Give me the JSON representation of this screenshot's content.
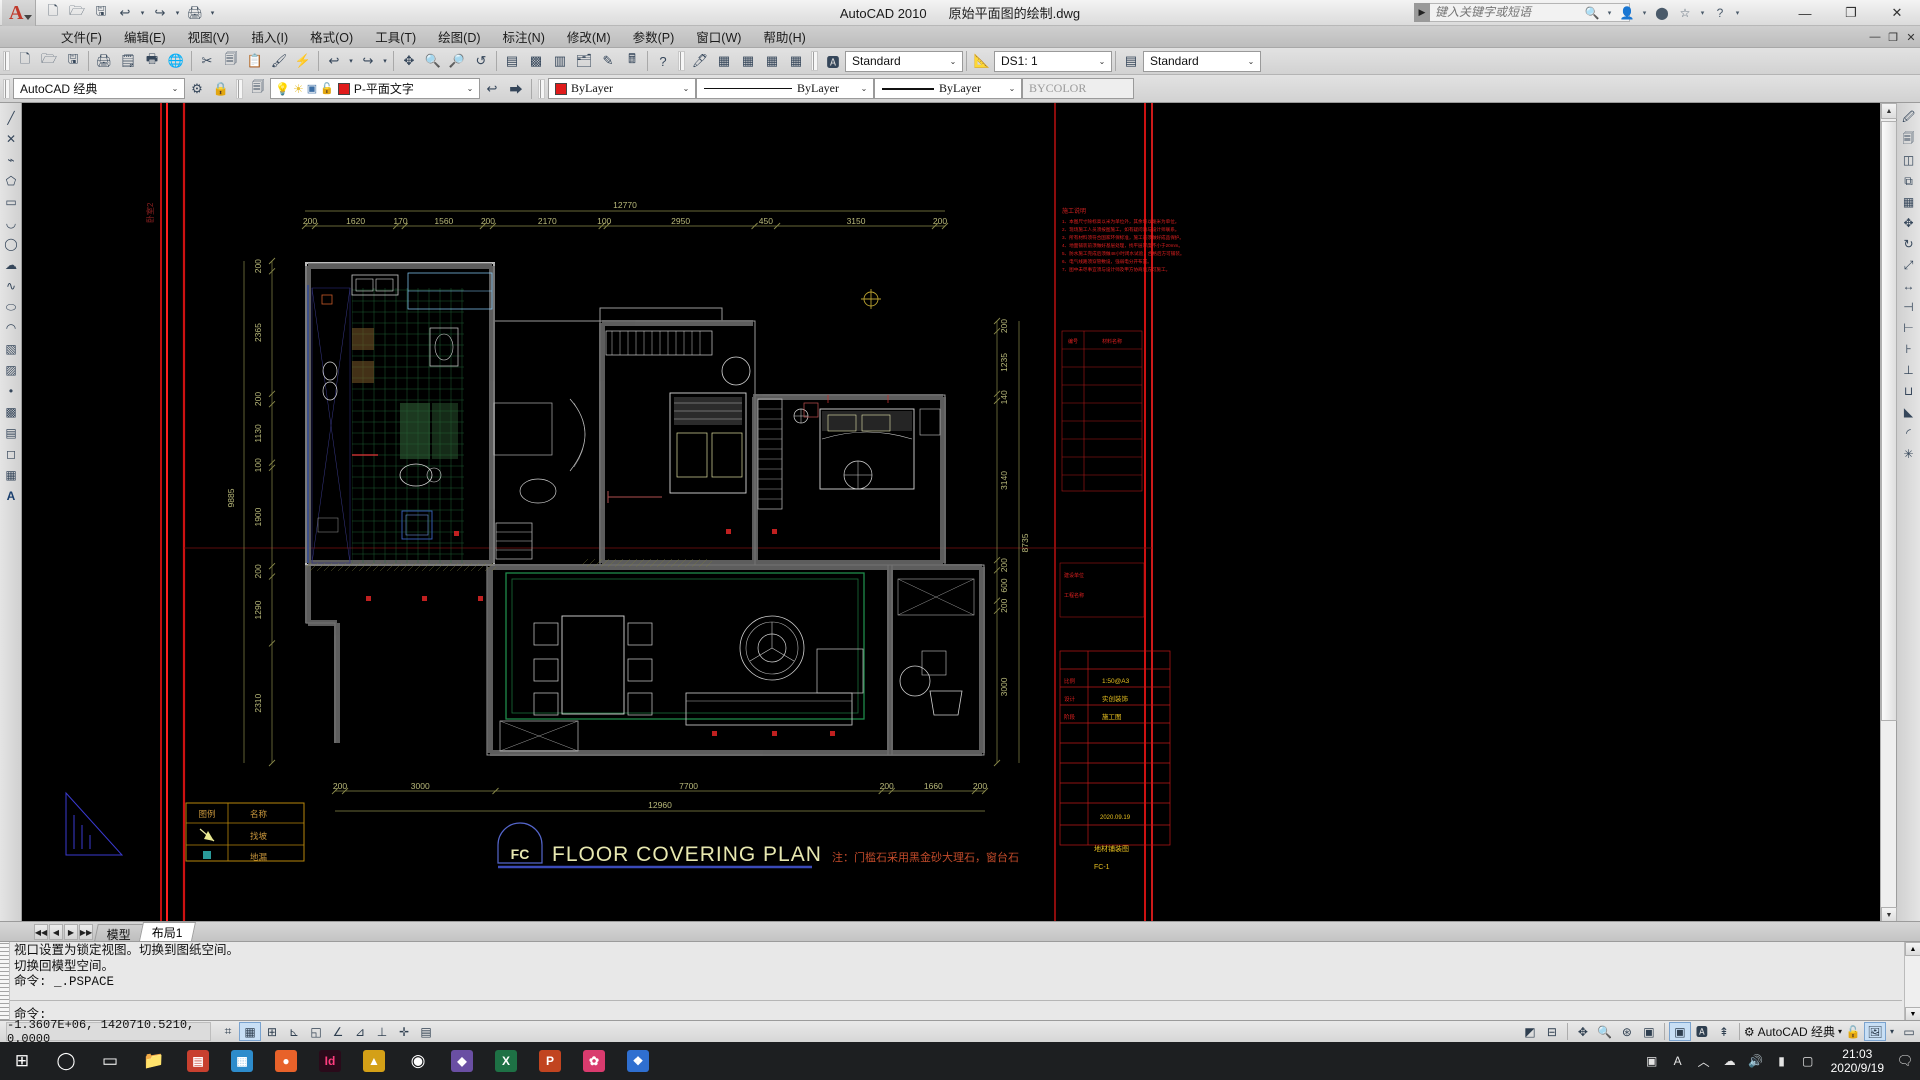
{
  "app": {
    "title": "AutoCAD 2010",
    "filename": "原始平面图的绘制.dwg",
    "search_placeholder": "键入关键字或短语"
  },
  "window_controls": {
    "minimize": "—",
    "maximize": "❐",
    "close": "✕"
  },
  "menubar": {
    "items": [
      {
        "label": "文件(F)"
      },
      {
        "label": "编辑(E)"
      },
      {
        "label": "视图(V)"
      },
      {
        "label": "插入(I)"
      },
      {
        "label": "格式(O)"
      },
      {
        "label": "工具(T)"
      },
      {
        "label": "绘图(D)"
      },
      {
        "label": "标注(N)"
      },
      {
        "label": "修改(M)"
      },
      {
        "label": "参数(P)"
      },
      {
        "label": "窗口(W)"
      },
      {
        "label": "帮助(H)"
      }
    ],
    "right_controls": [
      "—",
      "❐",
      "✕"
    ]
  },
  "toolbar_row1": {
    "text_style": "Standard",
    "dim_style": "DS1: 1",
    "table_style": "Standard"
  },
  "toolbar_row2": {
    "workspace": "AutoCAD 经典",
    "layer": "P-平面文字",
    "layer_color": "#e01b1b",
    "color_control": "ByLayer",
    "linetype_control": "ByLayer",
    "lineweight_control": "ByLayer",
    "plotstyle_control": "BYCOLOR"
  },
  "tabs": [
    {
      "label": "模型",
      "active": false
    },
    {
      "label": "布局1",
      "active": true
    }
  ],
  "command_line": {
    "history": [
      "视口设置为锁定视图。切换到图纸空间。",
      "切换回模型空间。",
      "命令: _.PSPACE"
    ],
    "prompt": "命令:"
  },
  "status_bar": {
    "coordinates": "-1.3607E+06,  1420710.5210,  0.0000",
    "workspace": "AutoCAD 经典"
  },
  "taskbar": {
    "time": "21:03",
    "date": "2020/9/19",
    "apps": [
      {
        "name": "start-button",
        "glyph": "⊞",
        "color": "#ffffff",
        "bg": "none"
      },
      {
        "name": "search-button",
        "glyph": "◯",
        "color": "#ffffff",
        "bg": "none"
      },
      {
        "name": "task-view-button",
        "glyph": "▭",
        "color": "#ffffff",
        "bg": "none"
      },
      {
        "name": "file-explorer",
        "glyph": "📁",
        "color": "#ffc83d",
        "bg": "none"
      },
      {
        "name": "app-red",
        "glyph": "▤",
        "color": "#ffffff",
        "bg": "#c8402f"
      },
      {
        "name": "app-store",
        "glyph": "▦",
        "color": "#ffffff",
        "bg": "#2d8ccc"
      },
      {
        "name": "app-orange",
        "glyph": "●",
        "color": "#ffffff",
        "bg": "#e8622a"
      },
      {
        "name": "indesign",
        "glyph": "Id",
        "color": "#ff3d7f",
        "bg": "#2a0a1a"
      },
      {
        "name": "app-yellow",
        "glyph": "▲",
        "color": "#ffffff",
        "bg": "#d4a017"
      },
      {
        "name": "chrome",
        "glyph": "◉",
        "color": "#ffffff",
        "bg": "none"
      },
      {
        "name": "app-purple",
        "glyph": "◆",
        "color": "#ffffff",
        "bg": "#6a4fa3"
      },
      {
        "name": "excel",
        "glyph": "X",
        "color": "#ffffff",
        "bg": "#1e7145"
      },
      {
        "name": "powerpoint",
        "glyph": "P",
        "color": "#ffffff",
        "bg": "#c14420"
      },
      {
        "name": "app-pink",
        "glyph": "✿",
        "color": "#ffffff",
        "bg": "#d93b6e"
      },
      {
        "name": "app-blue",
        "glyph": "❖",
        "color": "#ffffff",
        "bg": "#2f6fd0"
      }
    ],
    "tray": [
      {
        "name": "input-tool",
        "glyph": "▣"
      },
      {
        "name": "ime-indicator",
        "glyph": "A"
      },
      {
        "name": "chevron-up-icon",
        "glyph": "︿"
      },
      {
        "name": "cloud-icon",
        "glyph": "☁"
      },
      {
        "name": "volume-icon",
        "glyph": "🔊"
      },
      {
        "name": "network-icon",
        "glyph": "▮"
      },
      {
        "name": "action-center-icon",
        "glyph": "▢"
      }
    ]
  },
  "drawing": {
    "sheet_title": "FLOOR  COVERING  PLAN",
    "sheet_bubble": "FC",
    "note": "注：门槛石采用黑金砂大理石，窗台石",
    "legend": {
      "headers": [
        "图例",
        "名称"
      ],
      "rows": [
        {
          "symbol": "hatch",
          "name": "找坡"
        },
        {
          "symbol": "drain",
          "name": "地漏"
        }
      ]
    },
    "dim_top": [
      "200",
      "1620",
      "170",
      "1560",
      "200",
      "2170",
      "100",
      "2950",
      "450",
      "3150",
      "200"
    ],
    "dim_top_total": "12770",
    "dim_bottom": [
      "200",
      "3000",
      "7700",
      "200",
      "1660",
      "200"
    ],
    "dim_bottom_total": "12960",
    "dim_left": [
      "200",
      "2365",
      "200",
      "1130",
      "100",
      "1900",
      "200",
      "1290",
      "2310"
    ],
    "dim_left_total": "9885",
    "dim_right": [
      "200",
      "1235",
      "140",
      "3140",
      "200",
      "600",
      "200",
      "3000"
    ],
    "dim_right_total": "8735",
    "titleblock": {
      "scale_label": "比例",
      "scale": "1:50@A3",
      "company_label": "设计",
      "company": "实创装饰",
      "stage_label": "阶段",
      "stage": "施工图",
      "date": "2020.09.19",
      "sheet_label": "地材铺装图"
    }
  },
  "notes_block": {
    "title": "施工说明",
    "lines": [
      "1、本图尺寸除标高以米为单位外，其余均以毫米为单位。",
      "2、现场施工人员须按图施工，如有疑问请与设计师联系。",
      "3、所有材料须符合国家环保标准，施工前须做好成品保护。",
      "4、地面铺装前须做好基层处理，找平层厚度不小于20mm。",
      "5、防水施工完成后须做48小时闭水试验，合格后方可铺装。",
      "6、电气线路须穿管敷设，强弱电分开布置。",
      "7、图中未尽事宜须与设计师及甲方协商后方可施工。"
    ]
  }
}
